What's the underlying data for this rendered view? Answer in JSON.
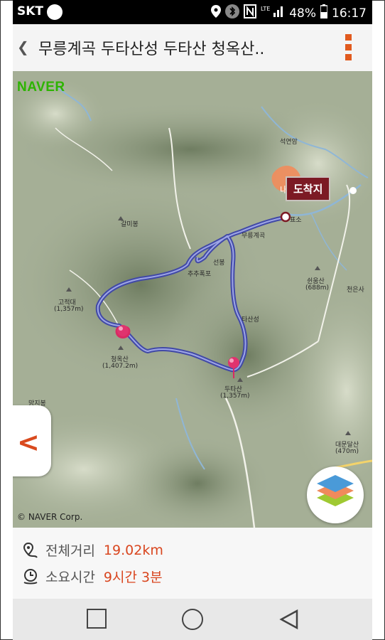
{
  "status_bar": {
    "carrier": "SKT",
    "network": "LTE",
    "battery": "48%",
    "time": "16:17",
    "icons": [
      "location-icon",
      "bluetooth-icon",
      "nfc-icon",
      "lte-icon",
      "signal-icon",
      "battery-icon"
    ]
  },
  "header": {
    "title": "무릉계곡 두타산성 두타산 청옥산.."
  },
  "map": {
    "brand": "NAVER",
    "copyright": "© NAVER Corp.",
    "arrival_label": "도착지",
    "start_marker_label": "내 위",
    "route_color": "#4149a6",
    "labels": {
      "seokyeonam": "석연암",
      "galmibong": "갈미봉",
      "mureunggyegok": "무릉계곡",
      "seonbong": "선봉",
      "chuchupokpo": "추추폭포",
      "gojeokdae": "고적대",
      "gojeokdae_height": "(1,357m)",
      "cheongoksan": "청옥산",
      "cheongoksan_height": "(1,407.2m)",
      "dutasanseong": "타산성",
      "dutasan": "두타산",
      "dutasan_height": "(1,357m)",
      "swiungsan": "쉰움산",
      "swiungsan_height": "(688m)",
      "cheoneunsa": "천은사",
      "manjibong": "망지봉",
      "daemundalsan": "대문달산",
      "daemundalsan_height": "(470m)",
      "pyoso": "표소"
    }
  },
  "info": {
    "distance_label": "전체거리",
    "distance_value": "19.02km",
    "time_label": "소요시간",
    "time_value": "9시간 3분"
  }
}
